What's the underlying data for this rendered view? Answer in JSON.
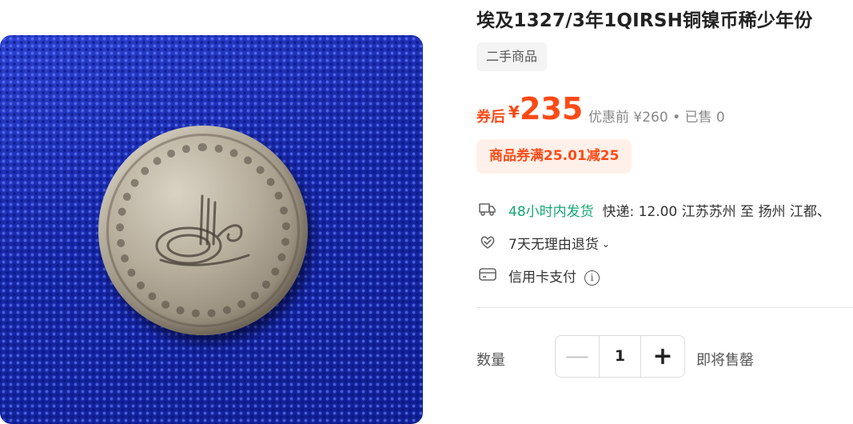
{
  "product": {
    "title": "埃及1327/3年1QIRSH铜镍币稀少年份",
    "condition_tag": "二手商品"
  },
  "price": {
    "prefix": "券后",
    "currency": "¥",
    "amount": "235",
    "original_and_sales": "优惠前 ¥260 • 已售 0"
  },
  "coupon": {
    "label": "商品券满25.01减25"
  },
  "shipping": {
    "icon": "delivery-truck-icon",
    "dispatch_time": "48小时内发货",
    "fee_and_route": "快递: 12.00  江苏苏州 至 扬州 江都、"
  },
  "returns": {
    "icon": "return-policy-icon",
    "label": "7天无理由退货"
  },
  "payment": {
    "icon": "credit-card-icon",
    "label": "信用卡支付",
    "info_glyph": "i"
  },
  "quantity": {
    "label": "数量",
    "minus_glyph": "—",
    "value": "1",
    "plus_glyph": "+",
    "stock_status": "即将售罄"
  },
  "colors": {
    "accent": "#ff4a16",
    "coupon_bg": "#fff1ea",
    "shipping_green": "#13a873"
  }
}
